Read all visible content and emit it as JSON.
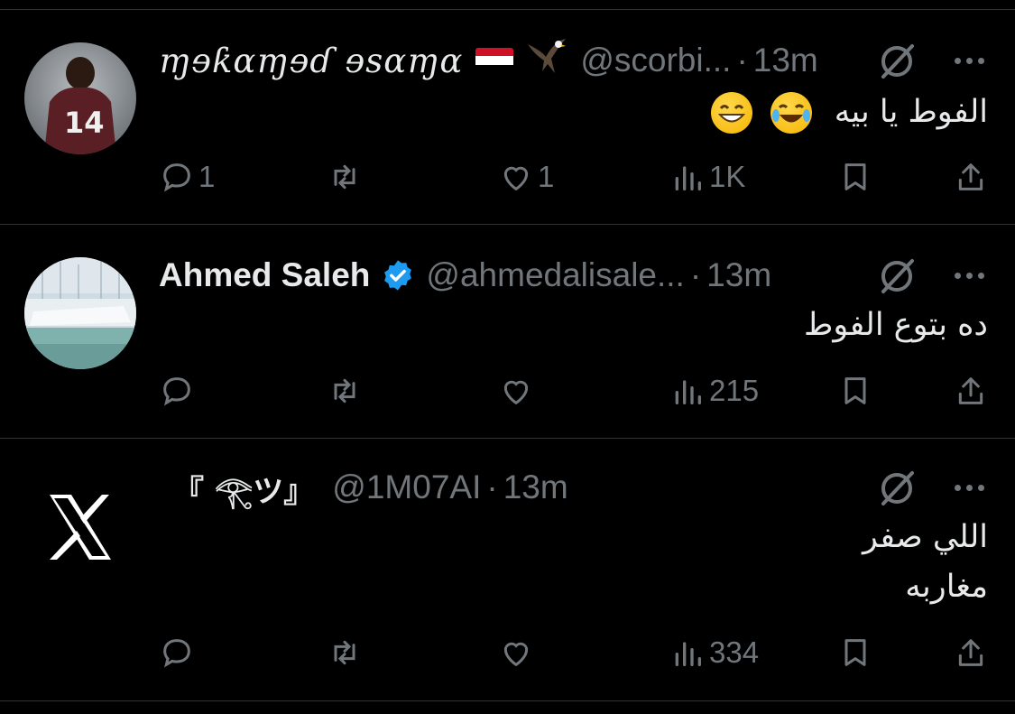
{
  "tweets": [
    {
      "name": "ɱɘƙɑɱɘɗ ɘsɑɱɑ",
      "flag": "egypt-flag",
      "extra_emoji": "🦅",
      "handle": "@scorbi...",
      "separator": "·",
      "time": "13m",
      "verified": false,
      "text_lines": [
        "الفوط يا بيه"
      ],
      "text_emojis": [
        "laughing-tears-emoji",
        "grinning-emoji"
      ],
      "replies": "1",
      "reposts": "",
      "likes": "1",
      "views": "1K",
      "avatar": "player-14-avatar"
    },
    {
      "name": "Ahmed Saleh",
      "handle": "@ahmedalisale...",
      "separator": "·",
      "time": "13m",
      "verified": true,
      "text_lines": [
        "ده بتوع الفوط"
      ],
      "replies": "",
      "reposts": "",
      "likes": "",
      "views": "215",
      "avatar": "marina-avatar"
    },
    {
      "name": "『 𓂀ツ』",
      "handle": "@1M07AI",
      "separator": "·",
      "time": "13m",
      "verified": false,
      "text_lines": [
        "اللي صفر",
        "مغاربه"
      ],
      "replies": "",
      "reposts": "",
      "likes": "",
      "views": "334",
      "avatar": "x-logo-avatar"
    }
  ],
  "colors": {
    "background": "#000000",
    "text": "#e7e9ea",
    "muted": "#71767b",
    "divider": "#2f3336",
    "verified": "#1d9bf0"
  }
}
